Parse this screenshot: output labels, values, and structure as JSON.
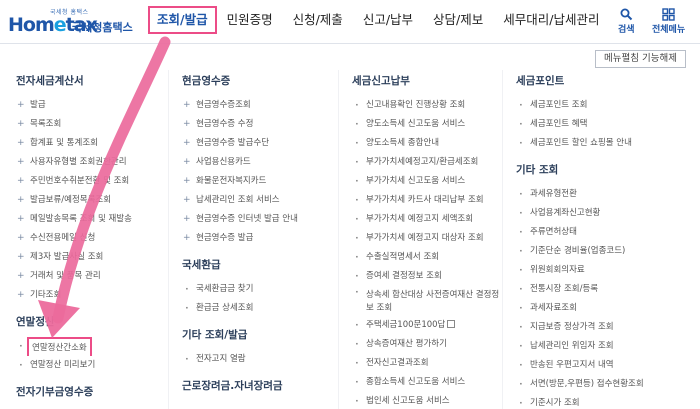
{
  "header": {
    "logo_tagline": "국세청 홈택스",
    "logo_brand_a": "Hom",
    "logo_brand_e": "e",
    "logo_brand_b": "tax",
    "logo_sub": "국세청홈택스",
    "nav": [
      "조회/발급",
      "민원증명",
      "신청/제출",
      "신고/납부",
      "상담/제보",
      "세무대리/납세관리"
    ],
    "search_label": "검색",
    "allmenu_label": "전체메뉴"
  },
  "submenu_button": "메뉴펼침 기능해제",
  "columns": {
    "col1": {
      "title": "전자세금계산서",
      "items": [
        "발급",
        "목록조회",
        "합계표 및 통계조회",
        "사용자유형별 조회권한관리",
        "주민번호수취분전환 및 조회",
        "발급보류/예정목록조회",
        "메일발송목록 조회 및 재발송",
        "수신전용메일 신청",
        "제3자 발급사실 조회",
        "거래처 및 품목 관리",
        "기타조회"
      ],
      "title2": "연말정산",
      "items2": [
        "연말정산간소화",
        "연말정산 미리보기"
      ],
      "title3": "전자기부금영수증"
    },
    "col2": {
      "title": "현금영수증",
      "items": [
        "현금영수증조회",
        "현금영수증 수정",
        "현금영수증 발급수단",
        "사업용신용카드",
        "화물운전자복지카드",
        "납세관리인 조회 서비스",
        "현금영수증 인터넷 발급 안내",
        "현금영수증 발급"
      ],
      "title2": "국세환급",
      "items2": [
        "국세환급금 찾기",
        "환급금 상세조회"
      ],
      "title3": "기타 조회/발급",
      "items3": [
        "전자고지 열람"
      ],
      "title4": "근로장려금.자녀장려금"
    },
    "col3": {
      "title": "세금신고납부",
      "items": [
        "신고내용확인 진행상황 조회",
        "양도소득세 신고도움 서비스",
        "양도소득세 종합안내",
        "부가가치세예정고지/환급세조회",
        "부가가치세 신고도움 서비스",
        "부가가치세 카드사 대리납부 조회",
        "부가가치세 예정고지 세액조회",
        "부가가치세 예정고지 대상자 조회",
        "수출실적명세서 조회",
        "증여세 결정정보 조회",
        "상속세 합산대상 사전증여재산 결정정보 조회",
        "주택세금100문100답",
        "상속증여재산 평가하기",
        "전자신고결과조회",
        "종합소득세 신고도움 서비스",
        "법인세 신고도움 서비스"
      ]
    },
    "col4": {
      "title": "세금포인트",
      "items": [
        "세금포인트 조회",
        "세금포인트 혜택",
        "세금포인트 할인 쇼핑몰 안내"
      ],
      "title2": "기타 조회",
      "items2": [
        "과세유형전환",
        "사업용계좌신고현황",
        "주류면허상태",
        "기준단순 경비율(업종코드)",
        "위원회회의자료",
        "전통시장 조회/등록",
        "과세자료조회",
        "지급보증 정상가격 조회",
        "납세관리인 위임자 조회",
        "반송된 우편고지서 내역",
        "서면(방문,우편등) 접수현황조회",
        "기준시가 조회"
      ]
    }
  }
}
